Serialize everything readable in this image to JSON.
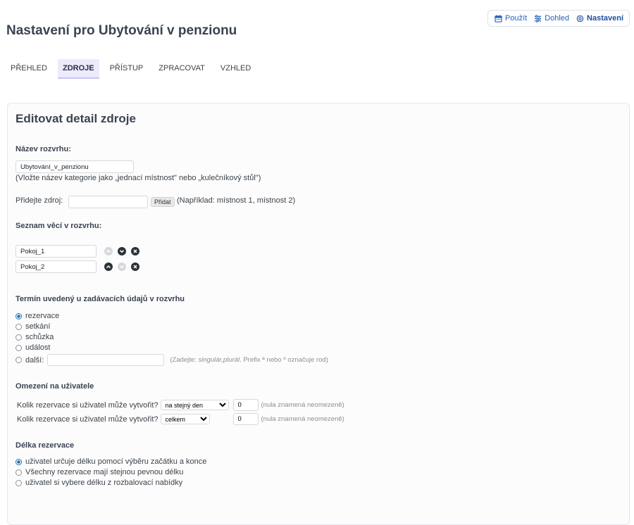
{
  "topmenu": {
    "use": "Použít",
    "supervise": "Dohled",
    "settings": "Nastavení"
  },
  "page_title": "Nastavení pro Ubytování v penzionu",
  "tabs": [
    "PŘEHLED",
    "ZDROJE",
    "PŘÍSTUP",
    "ZPRACOVAT",
    "VZHLED"
  ],
  "panel": {
    "title": "Editovat detail zdroje",
    "schedule_name": {
      "label": "Název rozvrhu:",
      "value": "Ubytování_v_penzionu",
      "hint": "(Vložte název kategorie jako „jednací místnost\" nebo „kulečníkový stůl\")"
    },
    "add_resource": {
      "label": "Přidejte zdroj:",
      "value": "",
      "button": "Přidat",
      "hint": "(Například: místnost 1, místnost 2)"
    },
    "items_list": {
      "label": "Seznam věcí v rozvrhu:",
      "items": [
        "Pokoj_1",
        "Pokoj_2"
      ]
    },
    "term": {
      "label": "Termín uvedený u zadávacích údajů v rozvrhu",
      "options": [
        "rezervace",
        "setkání",
        "schůzka",
        "událost",
        "další:"
      ],
      "selected": "rezervace",
      "other_value": "",
      "other_hint_prefix": "(Zadejte: ",
      "other_hint_em": "singulár,plurál",
      "other_hint_suffix": ". Prefix ª nebo º označuje rod)"
    },
    "user_limit": {
      "label": "Omezení na uživatele",
      "rows": [
        {
          "question": "Kolik rezervace si uživatel může vytvořit?",
          "select": "na stejný den",
          "value": "0",
          "hint": "(nula znamená neomezeně)"
        },
        {
          "question": "Kolik rezervace si uživatel může vytvořit?",
          "select": "celkem",
          "value": "0",
          "hint": "(nula znamená neomezeně)"
        }
      ]
    },
    "duration": {
      "label": "Délka rezervace",
      "options": [
        "uživatel určuje délku pomocí výběru začátku a konce",
        "Všechny rezervace mají stejnou pevnou délku",
        "uživatel si vybere délku z rozbalovací nabídky"
      ],
      "selected": 0
    }
  },
  "colors": {
    "accent": "#2563b8",
    "active_tab_bg": "#eceafb",
    "radio": "#2271b1"
  }
}
